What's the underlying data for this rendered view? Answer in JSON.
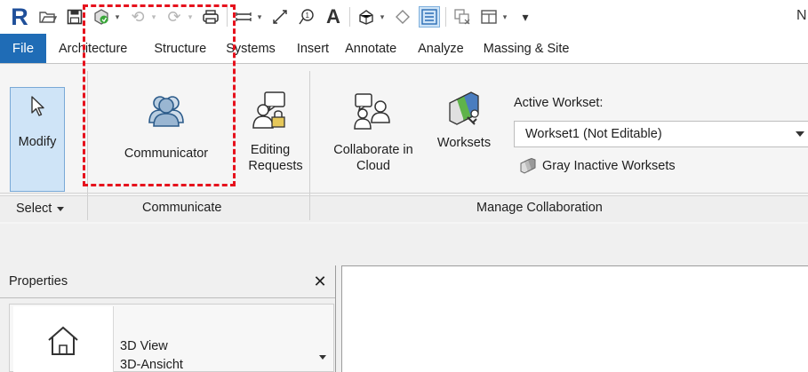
{
  "qat": {
    "logo_letter": "R",
    "truncated_label": "N"
  },
  "tabs": [
    "File",
    "Architecture",
    "Structure",
    "Systems",
    "Insert",
    "Annotate",
    "Analyze",
    "Massing & Site"
  ],
  "ribbon": {
    "modify_label": "Modify",
    "select_label": "Select",
    "communicator_label": "Communicator",
    "editing_requests_label_1": "Editing",
    "editing_requests_label_2": "Requests",
    "collaborate_label_1": "Collaborate in",
    "collaborate_label_2": "Cloud",
    "worksets_label": "Worksets",
    "active_workset_label": "Active Workset:",
    "active_workset_value": "Workset1 (Not Editable)",
    "gray_inactive_label": "Gray Inactive Worksets",
    "panels": {
      "communicate": "Communicate",
      "manage_collaboration": "Manage Collaboration"
    }
  },
  "properties": {
    "title": "Properties",
    "type_line1": "3D View",
    "type_line2": "3D-Ansicht"
  },
  "colors": {
    "file_tab": "#1f6cb6",
    "highlight": "#e6121d",
    "active_button": "#cfe4f7"
  }
}
